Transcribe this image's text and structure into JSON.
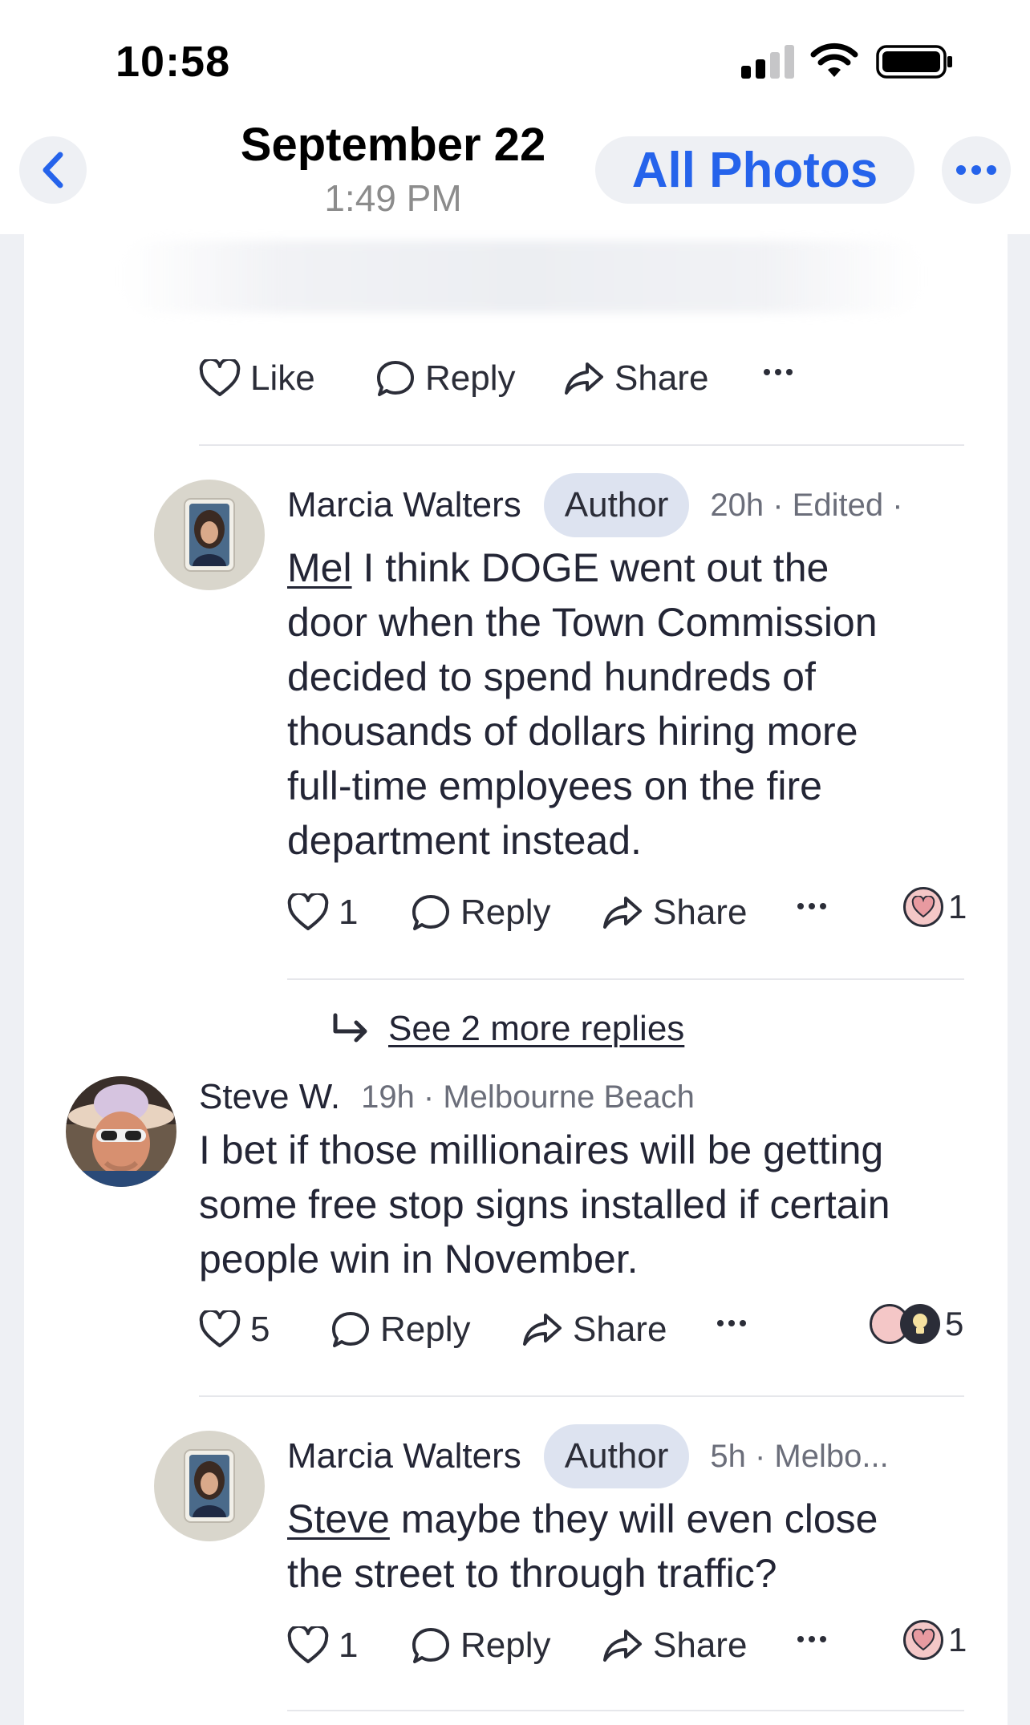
{
  "status_bar": {
    "time": "10:58"
  },
  "header": {
    "date": "September 22",
    "time": "1:49 PM",
    "all_photos_label": "All Photos"
  },
  "top_actions": {
    "like": "Like",
    "reply": "Reply",
    "share": "Share"
  },
  "comments": [
    {
      "name": "Marcia Walters",
      "badge": "Author",
      "meta": "20h · Edited ·",
      "mention": "Mel",
      "lines": [
        " I think DOGE went out the",
        "door when the Town Commission",
        "decided to spend hundreds of",
        "thousands of dollars hiring more",
        "full-time employees on the fire",
        "department instead."
      ],
      "like_count": "1",
      "reply": "Reply",
      "share": "Share",
      "reaction_count": "1"
    },
    {
      "name": "Steve W.",
      "meta": "19h · Melbourne Beach",
      "lines": [
        "I bet if those millionaires will be getting",
        "some free stop signs installed if certain",
        "people win in November."
      ],
      "like_count": "5",
      "reply": "Reply",
      "share": "Share",
      "reaction_count": "5"
    },
    {
      "name": "Marcia Walters",
      "badge": "Author",
      "meta": "5h · Melbo...",
      "mention": "Steve",
      "lines": [
        " maybe they will even close",
        "the street to through traffic?"
      ],
      "like_count": "1",
      "reply": "Reply",
      "share": "Share",
      "reaction_count": "1"
    }
  ],
  "see_more_replies": "See 2 more replies",
  "colors": {
    "accent": "#2563eb",
    "badge_bg": "#dde3f0",
    "reaction_heart": "#f4c7c7"
  },
  "icons": [
    "chevron-left-icon",
    "ellipsis-icon",
    "heart-icon",
    "reply-bubble-icon",
    "share-arrow-icon",
    "reply-arrow-icon",
    "lightbulb-icon"
  ]
}
